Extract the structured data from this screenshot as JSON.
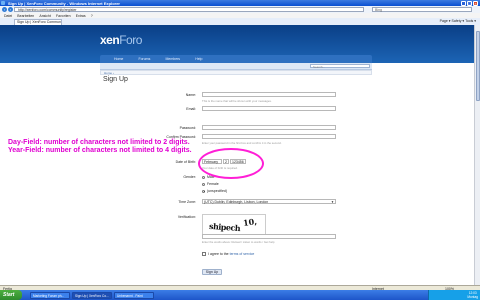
{
  "window": {
    "title": "Sign Up | XenForo Community - Windows Internet Explorer",
    "url": "http://xenforo.com/community/register",
    "search_placeholder": "Bing",
    "tab_title": "Sign Up | XenForo Community",
    "tools": "Page ▾  Safety ▾  Tools ▾",
    "menu": [
      "Datei",
      "Bearbeiten",
      "Ansicht",
      "Favoriten",
      "Extras",
      "?"
    ]
  },
  "site": {
    "logo_bold": "xen",
    "logo_light": "Foro",
    "nav": [
      "Home",
      "Forums",
      "Members",
      "Help"
    ],
    "search_placeholder": "Search...",
    "breadcrumb": "Home ›"
  },
  "form": {
    "title": "Sign Up",
    "name_label": "Name:",
    "name_hint": "This is the name that will be shown with your messages.",
    "email_label": "Email:",
    "password_label": "Password:",
    "confirm_label": "Confirm Password:",
    "password_hint": "Enter your password in the first box and confirm it in the second.",
    "dob_label": "Date of Birth:",
    "dob_month": "February",
    "dob_day": "2",
    "dob_year": "123456",
    "dob_hint": "Your date of birth is required.",
    "gender_label": "Gender:",
    "gender_options": [
      "Male",
      "Female",
      "(unspecified)"
    ],
    "gender_selected": "(unspecified)",
    "timezone_label": "Time Zone:",
    "timezone_value": "(UTC) Dublin, Edinburgh, Lisbon, London",
    "verification_label": "Verification:",
    "captcha_words": [
      "shipech",
      "10,"
    ],
    "captcha_hint": "Enter the words above: Reload / Listen to words / Get help",
    "agree_text_prefix": "I agree to the",
    "agree_link": "terms of service",
    "submit_label": "Sign Up"
  },
  "annotation": {
    "line1": "Day-Field: number of characters not limited to 2 digits.",
    "line2": "Year-Field: number of characters not limited to 4 digits.",
    "color": "#e000d0"
  },
  "statusbar": {
    "status": "Fertig",
    "zone": "Internet",
    "zoom": "100%"
  },
  "taskbar": {
    "start": "Start",
    "tasks": [
      "Marketing Forum ph...",
      "Sign Up | XenForo Co...",
      "Unbenannt - Paint"
    ],
    "time": "12:03",
    "day": "Montag"
  }
}
